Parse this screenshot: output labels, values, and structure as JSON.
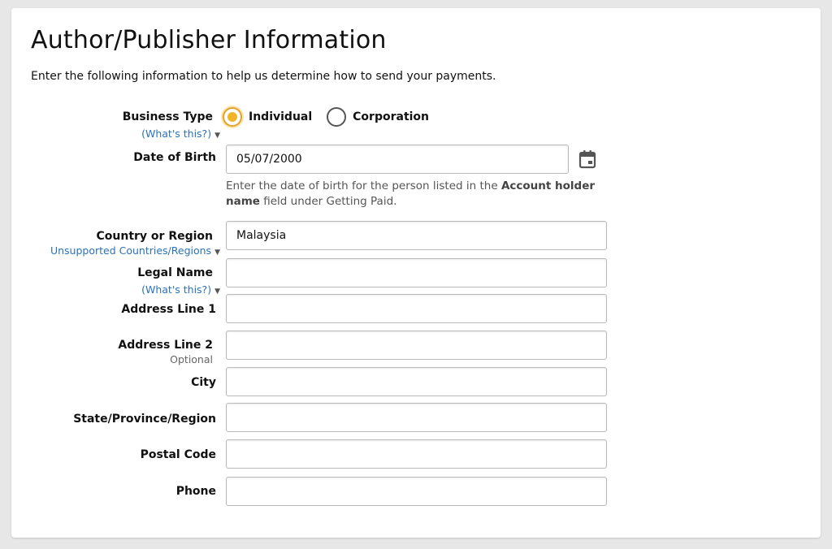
{
  "header": {
    "title": "Author/Publisher Information",
    "subtitle": "Enter the following information to help us determine how to send your payments."
  },
  "business_type": {
    "label": "Business Type",
    "link": "(What's this?)",
    "options": [
      {
        "label": "Individual",
        "selected": true
      },
      {
        "label": "Corporation",
        "selected": false
      }
    ]
  },
  "dob": {
    "label": "Date of Birth",
    "value": "05/07/2000",
    "help_prefix": "Enter the date of birth for the person listed in the ",
    "help_bold": "Account holder name",
    "help_suffix": " field under Getting Paid."
  },
  "country": {
    "label": "Country or Region",
    "link": "Unsupported Countries/Regions",
    "value": "Malaysia"
  },
  "legal_name": {
    "label": "Legal Name",
    "link": "(What's this?)",
    "value": ""
  },
  "address1": {
    "label": "Address Line 1",
    "value": ""
  },
  "address2": {
    "label": "Address Line 2",
    "note": "Optional",
    "value": ""
  },
  "city": {
    "label": "City",
    "value": ""
  },
  "state": {
    "label": "State/Province/Region",
    "value": ""
  },
  "postal": {
    "label": "Postal Code",
    "value": ""
  },
  "phone": {
    "label": "Phone",
    "value": ""
  },
  "colors": {
    "accent": "#f0b429",
    "link": "#2a72b8"
  }
}
